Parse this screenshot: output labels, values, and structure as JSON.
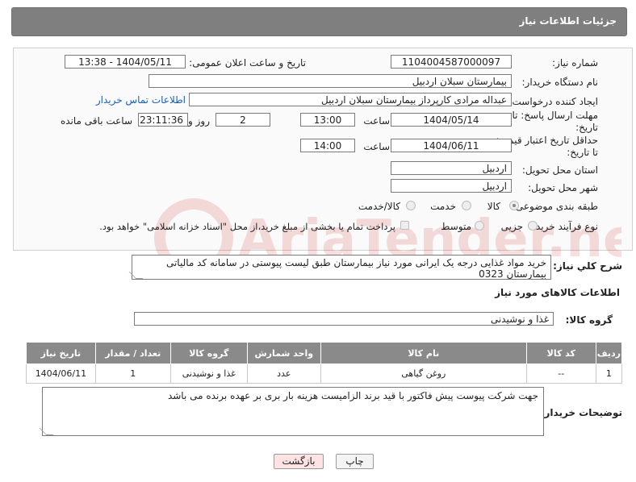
{
  "header": {
    "title": "جزئیات اطلاعات نیاز"
  },
  "form": {
    "need_number": {
      "label": "شماره نیاز:",
      "value": "1104004587000097"
    },
    "announce_datetime": {
      "label": "تاریخ و ساعت اعلان عمومی:",
      "value": "1404/05/11 - 13:38"
    },
    "buyer_org": {
      "label": "نام دستگاه خریدار:",
      "value": "بیمارستان سبلان اردبیل"
    },
    "requester": {
      "label": "ایجاد کننده درخواست:",
      "value": "عبداله مرادی کارپرداز بیمارستان سبلان اردبیل",
      "contact_link": "اطلاعات تماس خریدار"
    },
    "reply_deadline": {
      "label_line1": "مهلت ارسال پاسخ: تا",
      "label_line2": "تاریخ:",
      "date": "1404/05/14",
      "time_label": "ساعت",
      "time": "13:00",
      "days": "2",
      "days_label": "روز و",
      "remaining": "23:11:36",
      "remaining_label": "ساعت باقی مانده"
    },
    "price_validity": {
      "label_line1": "حداقل تاریخ اعتبار قیمت:",
      "label_line2": "تا تاریخ:",
      "date": "1404/06/11",
      "time_label": "ساعت",
      "time": "14:00"
    },
    "delivery_province": {
      "label": "استان محل تحویل:",
      "value": "اردبیل"
    },
    "delivery_city": {
      "label": "شهر محل تحویل:",
      "value": "اردبیل"
    },
    "category": {
      "label": "طبقه بندی موضوعی:",
      "options": [
        "کالا",
        "خدمت",
        "کالا/خدمت"
      ],
      "selected": "کالا"
    },
    "purchase_type": {
      "label": "نوع فرآیند خرید :",
      "options": [
        "جزیی",
        "متوسط"
      ],
      "note": "پرداخت تمام یا بخشی از مبلغ خرید،از محل \"اسناد خزانه اسلامی\" خواهد بود."
    }
  },
  "description": {
    "label": "شرح کلي نياز:",
    "value": "خرید مواد غذایی درجه یک ایرانی مورد نیاز بیمارستان طبق لیست پیوستی در سامانه کد مالیاتی بیمارستان 0323"
  },
  "goods_info": {
    "title": "اطلاعات کالاهای مورد نیاز"
  },
  "goods_group": {
    "label": "گروه کالا:",
    "value": "غذا و نوشیدنی"
  },
  "table": {
    "headers": [
      "ردیف",
      "کد کالا",
      "نام کالا",
      "واحد شمارش",
      "گروه کالا",
      "تعداد / مقدار",
      "تاریخ نیاز"
    ],
    "rows": [
      [
        "1",
        "--",
        "روغن گیاهی",
        "عدد",
        "غذا و نوشیدنی",
        "1",
        "1404/06/11"
      ]
    ]
  },
  "buyer_notes": {
    "label": "توضیحات خریدار:",
    "value": "جهت شرکت پیوست پیش فاکتور با قید برند الزامیست هزینه بار بری بر عهده برنده می باشد"
  },
  "buttons": {
    "print": "چاپ",
    "back": "بازگشت"
  },
  "watermark": {
    "text": "AriaTender.net"
  },
  "colors": {
    "header_bg": "#7f7f7f",
    "table_header_bg": "#8a8a8a",
    "link": "#1a5fb4",
    "back_button_bg": "#fde3e3"
  }
}
